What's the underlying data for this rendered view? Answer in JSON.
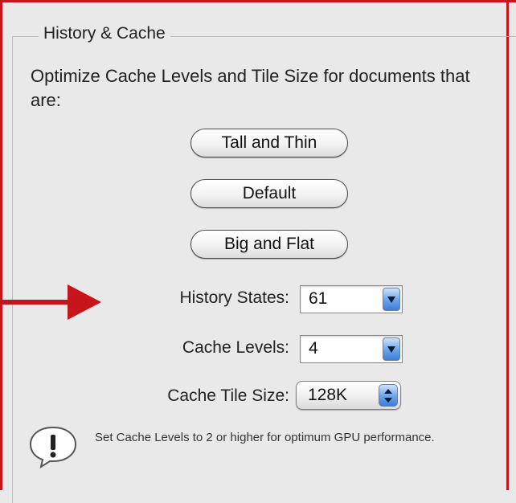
{
  "panel": {
    "group_title": "History & Cache",
    "description": "Optimize Cache Levels and Tile Size for documents that are:"
  },
  "buttons": {
    "tall_and_thin": "Tall and Thin",
    "default": "Default",
    "big_and_flat": "Big and Flat"
  },
  "fields": {
    "history_states": {
      "label": "History States:",
      "value": "61"
    },
    "cache_levels": {
      "label": "Cache Levels:",
      "value": "4"
    },
    "cache_tile_size": {
      "label": "Cache Tile Size:",
      "value": "128K"
    }
  },
  "notice": {
    "icon": "exclamation-icon",
    "text": "Set Cache Levels to 2 or higher for optimum GPU performance."
  },
  "colors": {
    "frame_accent": "#c8141b",
    "control_blue": "#3c7dd8"
  }
}
